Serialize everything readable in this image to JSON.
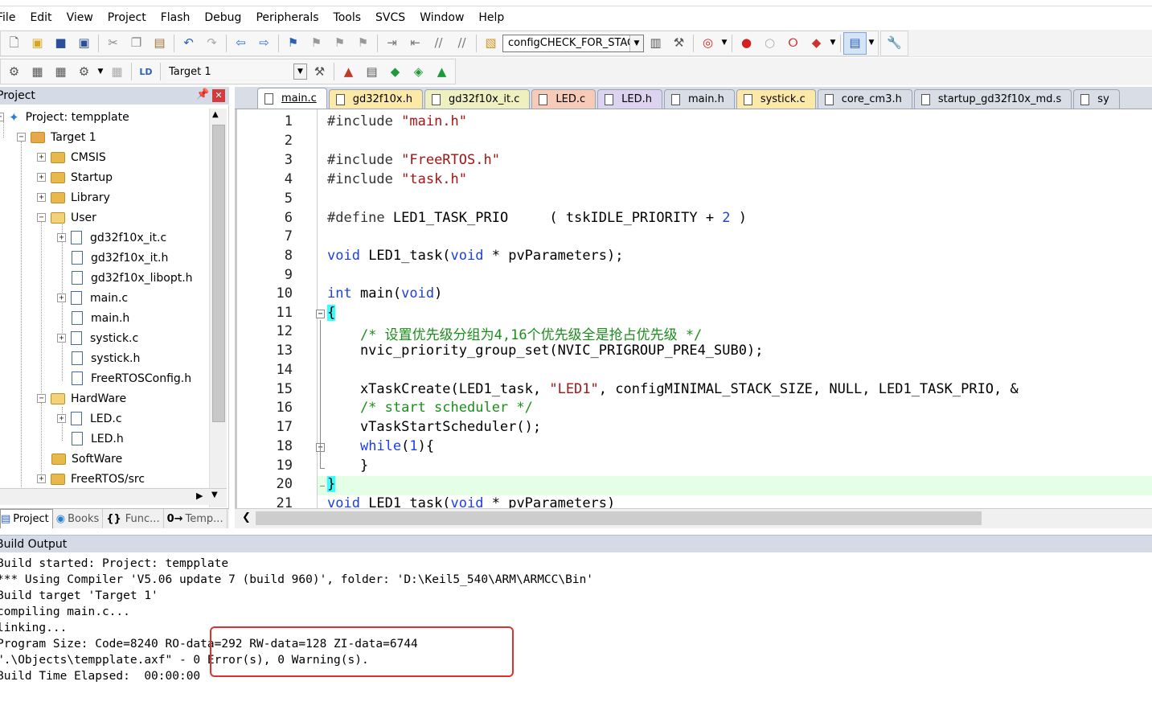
{
  "menubar": {
    "items": [
      "File",
      "Edit",
      "View",
      "Project",
      "Flash",
      "Debug",
      "Peripherals",
      "Tools",
      "SVCS",
      "Window",
      "Help"
    ]
  },
  "toolbar1": {
    "find_combo_value": "configCHECK_FOR_STACK"
  },
  "toolbar2": {
    "target_combo_value": "Target 1"
  },
  "project_panel": {
    "title": "Project",
    "pin_glyph": "―",
    "close_glyph": "✕",
    "tree": [
      {
        "label": "Project: tempplate",
        "icon": "project-icon",
        "expander": "−"
      },
      {
        "label": "Target 1",
        "icon": "target-icon",
        "expander": "−"
      },
      {
        "label": "CMSIS",
        "icon": "folder-icon",
        "expander": "+"
      },
      {
        "label": "Startup",
        "icon": "folder-icon",
        "expander": "+"
      },
      {
        "label": "Library",
        "icon": "folder-icon",
        "expander": "+"
      },
      {
        "label": "User",
        "icon": "folder-open-icon",
        "expander": "−"
      },
      {
        "label": "gd32f10x_it.c",
        "icon": "file-icon",
        "expander": "+"
      },
      {
        "label": "gd32f10x_it.h",
        "icon": "file-icon",
        "expander": ""
      },
      {
        "label": "gd32f10x_libopt.h",
        "icon": "file-icon",
        "expander": ""
      },
      {
        "label": "main.c",
        "icon": "file-icon",
        "expander": "+"
      },
      {
        "label": "main.h",
        "icon": "file-icon",
        "expander": ""
      },
      {
        "label": "systick.c",
        "icon": "file-icon",
        "expander": "+"
      },
      {
        "label": "systick.h",
        "icon": "file-icon",
        "expander": ""
      },
      {
        "label": "FreeRTOSConfig.h",
        "icon": "file-icon",
        "expander": ""
      },
      {
        "label": "HardWare",
        "icon": "folder-open-icon",
        "expander": "−"
      },
      {
        "label": "LED.c",
        "icon": "file-icon",
        "expander": "+"
      },
      {
        "label": "LED.h",
        "icon": "file-icon",
        "expander": ""
      },
      {
        "label": "SoftWare",
        "icon": "folder-icon",
        "expander": ""
      },
      {
        "label": "FreeRTOS/src",
        "icon": "folder-icon",
        "expander": "+"
      }
    ],
    "tabs": [
      {
        "label": "Project",
        "active": true
      },
      {
        "label": "Books",
        "active": false
      },
      {
        "label": "Func...",
        "active": false
      },
      {
        "label": "Temp...",
        "active": false
      }
    ],
    "tab_icons": [
      "▤",
      "◉",
      "{}",
      "0→"
    ]
  },
  "editor": {
    "tabs": [
      {
        "label": "main.c",
        "color": "#ffffff",
        "active": true
      },
      {
        "label": "gd32f10x.h",
        "color": "#fce9a8"
      },
      {
        "label": "gd32f10x_it.c",
        "color": "#eef0c0"
      },
      {
        "label": "LED.c",
        "color": "#f8cbb8"
      },
      {
        "label": "LED.h",
        "color": "#dcd3f0"
      },
      {
        "label": "main.h",
        "color": "#d9dde6"
      },
      {
        "label": "systick.c",
        "color": "#fce9a8"
      },
      {
        "label": "core_cm3.h",
        "color": "#d9dde6"
      },
      {
        "label": "startup_gd32f10x_md.s",
        "color": "#d9dde6"
      },
      {
        "label": "sy",
        "color": "#d9dde6"
      }
    ],
    "line_numbers": [
      "1",
      "2",
      "3",
      "4",
      "5",
      "6",
      "7",
      "8",
      "9",
      "10",
      "11",
      "12",
      "13",
      "14",
      "15",
      "16",
      "17",
      "18",
      "19",
      "20",
      "21"
    ],
    "code": {
      "l1_a": "#include ",
      "l1_b": "\"main.h\"",
      "l3_a": "#include ",
      "l3_b": "\"FreeRTOS.h\"",
      "l4_a": "#include ",
      "l4_b": "\"task.h\"",
      "l6_a": "#define ",
      "l6_b": "LED1_TASK_PRIO     ( tskIDLE_PRIORITY + ",
      "l6_c": "2",
      "l6_d": " )",
      "l8_a": "void",
      "l8_b": " LED1_task(",
      "l8_c": "void",
      "l8_d": " * pvParameters);",
      "l10_a": "int",
      "l10_b": " main(",
      "l10_c": "void",
      "l10_d": ")",
      "l11": "{",
      "l12": "    /* 设置优先级分组为4,16个优先级全是抢占优先级 */",
      "l13": "    nvic_priority_group_set(NVIC_PRIGROUP_PRE4_SUB0);",
      "l15_a": "    xTaskCreate(LED1_task, ",
      "l15_b": "\"LED1\"",
      "l15_c": ", configMINIMAL_STACK_SIZE, NULL, LED1_TASK_PRIO, &",
      "l16": "    /* start scheduler */",
      "l17": "    vTaskStartScheduler();",
      "l18_a": "    ",
      "l18_b": "while",
      "l18_c": "(",
      "l18_d": "1",
      "l18_e": "){",
      "l19": "    }",
      "l20": "}",
      "l21_a": "void",
      "l21_b": " LED1_task(",
      "l21_c": "void",
      "l21_d": " * pvParameters)"
    }
  },
  "build_output": {
    "title": "Build Output",
    "lines": [
      "Build started: Project: tempplate",
      "*** Using Compiler 'V5.06 update 7 (build 960)', folder: 'D:\\Keil5_540\\ARM\\ARMCC\\Bin'",
      "Build target 'Target 1'",
      "compiling main.c...",
      "linking...",
      "Program Size: Code=8240 RO-data=292 RW-data=128 ZI-data=6744",
      "\".\\Objects\\tempplate.axf\" - 0 Error(s), 0 Warning(s).",
      "Build Time Elapsed:  00:00:00"
    ]
  },
  "colors": {
    "keyword": "#1b3fe3",
    "string": "#a31515",
    "comment": "#1b8d1b",
    "current_line": "#e4ffe6",
    "annotation_box": "#e0322b"
  }
}
